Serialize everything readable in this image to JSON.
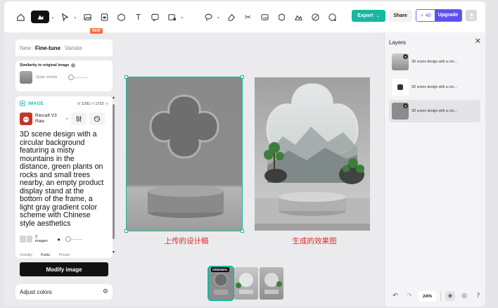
{
  "toolbar": {
    "new_badge": "NEW",
    "export_label": "Export",
    "share_label": "Share",
    "credits": "40",
    "upgrade_label": "Upgrade"
  },
  "left_panel": {
    "tabs": [
      "New",
      "Fine-tune",
      "Variate"
    ],
    "active_tab": "Fine-tune",
    "similarity": {
      "title": "Similarity to original image",
      "level_label": "Quite similar"
    },
    "image": {
      "section_label": "IMAGE",
      "width_label": "W",
      "width": "1291",
      "height_label": "H",
      "height": "1722",
      "model_name": "Recraft V3 Raw",
      "prompt": "3D scene design with a circular background featuring a misty mountains in the distance, green plants on rocks and small trees nearby, an empty product display stand at the bottom of the frame, a light gray gradient color scheme with Chinese style aesthetics",
      "count": "2",
      "count_unit": "images",
      "visibility_label": "Visibility",
      "visibility_options": [
        "Public",
        "Private"
      ]
    },
    "modify_button": "Modify image",
    "adjust_colors": "Adjust colors"
  },
  "canvas": {
    "caption_left": "上传的设计稿",
    "caption_right": "生成的效果图",
    "original_badge": "ORIGINAL"
  },
  "layers": {
    "title": "Layers",
    "items": [
      {
        "name": "3D scene design with a circ..."
      },
      {
        "name": "3D scene design with a circ..."
      },
      {
        "name": "3D scene design with a circ..."
      }
    ],
    "zoom": "24%"
  },
  "colors": {
    "accent": "#16b8a0",
    "upgrade": "#5a52f0",
    "caption_red": "#e0282c"
  }
}
